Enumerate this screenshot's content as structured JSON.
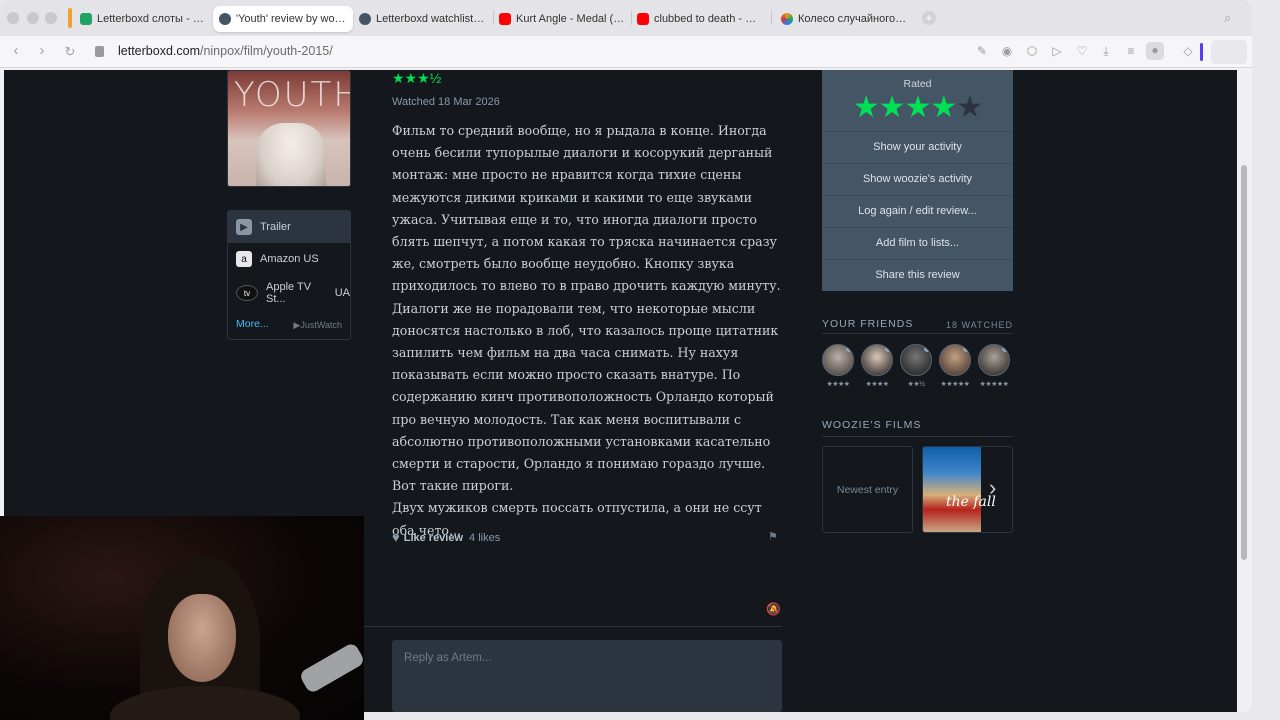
{
  "browser": {
    "tabs": [
      {
        "title": "Letterboxd слоты - Goog",
        "favicon_color": "#1fa463"
      },
      {
        "title": "'Youth' review by woozie",
        "favicon_color": "#445566",
        "active": true
      },
      {
        "title": "Letterboxd watchlist pic",
        "favicon_color": "#445566"
      },
      {
        "title": "Kurt Angle - Medal (Entr",
        "favicon_color": "#ff0000"
      },
      {
        "title": "clubbed to death - Matri",
        "favicon_color": "#ff0000"
      },
      {
        "title": "Колесо случайного выб",
        "favicon_color": "#e0a020"
      }
    ],
    "url_domain": "letterboxd.com",
    "url_path": "/ninpox/film/youth-2015/"
  },
  "film": {
    "poster_title": "YOUTH"
  },
  "services": {
    "trailer": "Trailer",
    "amazon": "Amazon US",
    "apple": "Apple TV St...",
    "apple_region": "UA",
    "more": "More...",
    "justwatch": "JustWatch"
  },
  "review": {
    "rating_stars": "★★★½",
    "watched": "Watched 18 Mar 2026",
    "body": "Фильм то средний вообще, но я рыдала в конце. Иногда очень бесили тупорылые диалоги и косорукий дерганый монтаж: мне просто не нравится когда тихие сцены межуются дикими криками и какими то еще звуками ужаса. Учитывая еще и то, что иногда диалоги просто блять шепчут, а потом какая то тряска начинается сразу же, смотреть было вообще неудобно. Кнопку звука приходилось то влево то в право дрочить каждую минуту. Диалоги же не порадовали тем, что некоторые мысли доносятся настолько в лоб, что казалось проще цитатник запилить чем фильм на два часа снимать. Ну нахуя показывать если можно просто сказать внатуре. По содержанию кинч противоположность Орландо который про вечную молодость.  Так как меня воспитывали с абсолютно противоположными установками касательно смерти и старости, Орландо я понимаю гораздо лучше. Вот такие пироги.",
    "body_line2": "Двух мужиков смерть поссать отпустила, а они не ссут",
    "body_line3": "оба чето...",
    "like_label": "Like review",
    "likes": "4 likes",
    "reply_placeholder": "Reply as Artem..."
  },
  "sidebar": {
    "rated_label": "Rated",
    "rated_value": 4,
    "actions": [
      "Show your activity",
      "Show woozie's activity",
      "Log again / edit review...",
      "Add film to lists...",
      "Share this review"
    ],
    "friends_title": "YOUR FRIENDS",
    "friends_count": "18 WATCHED",
    "friend_ratings": [
      "★★★★",
      "★★★★",
      "★★½",
      "★★★★★",
      "★★★★★"
    ],
    "films_title": "WOOZIE'S FILMS",
    "newest": "Newest entry",
    "latest_film_poster_text": "the fall"
  },
  "colors": {
    "page_bg": "#14181c",
    "green": "#00e054",
    "panel": "#445566",
    "link": "#40bcf4"
  }
}
